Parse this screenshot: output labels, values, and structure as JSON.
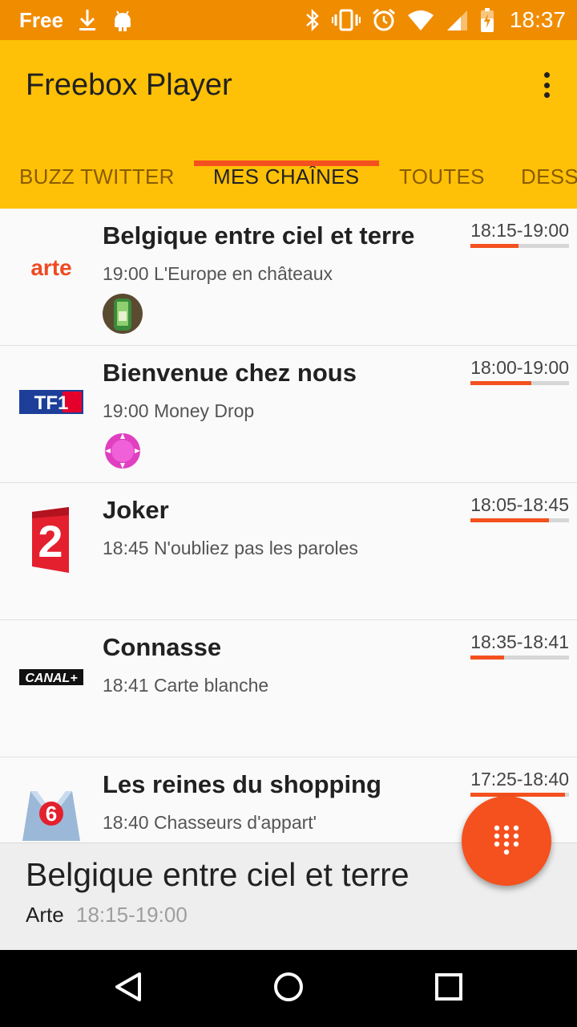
{
  "status_bar": {
    "carrier": "Free",
    "time": "18:37"
  },
  "app": {
    "title": "Freebox Player"
  },
  "tabs": [
    {
      "label": "BUZZ TWITTER",
      "active": false
    },
    {
      "label": "MES CHAÎNES",
      "active": true
    },
    {
      "label": "TOUTES",
      "active": false
    },
    {
      "label": "DESSINS ANIMÉS",
      "active": false
    }
  ],
  "programs": [
    {
      "channel": "arte",
      "title": "Belgique entre ciel et terre",
      "next": "19:00 L'Europe en châteaux",
      "time": "18:15-19:00",
      "progress": 0.49,
      "has_avatar": true
    },
    {
      "channel": "TF1",
      "title": "Bienvenue chez nous",
      "next": "19:00 Money Drop",
      "time": "18:00-19:00",
      "progress": 0.62,
      "has_avatar": true
    },
    {
      "channel": "France 2",
      "title": "Joker",
      "next": "18:45 N'oubliez pas les paroles",
      "time": "18:05-18:45",
      "progress": 0.8,
      "has_avatar": false
    },
    {
      "channel": "CANAL+",
      "title": "Connasse",
      "next": "18:41 Carte blanche",
      "time": "18:35-18:41",
      "progress": 0.34,
      "has_avatar": false
    },
    {
      "channel": "M6",
      "title": "Les reines du shopping",
      "next": "18:40 Chasseurs d'appart'",
      "time": "17:25-18:40",
      "progress": 0.96,
      "has_avatar": false
    }
  ],
  "logos": {
    "arte": "arte",
    "tf1": "TF1",
    "france2": "2",
    "canal": "CANAL+",
    "m6": "6"
  },
  "now_playing": {
    "title": "Belgique entre ciel et terre",
    "channel": "Arte",
    "time": "18:15-19:00"
  },
  "colors": {
    "status_bar": "#f08c00",
    "app_bar": "#ffc107",
    "accent": "#f4511e"
  }
}
